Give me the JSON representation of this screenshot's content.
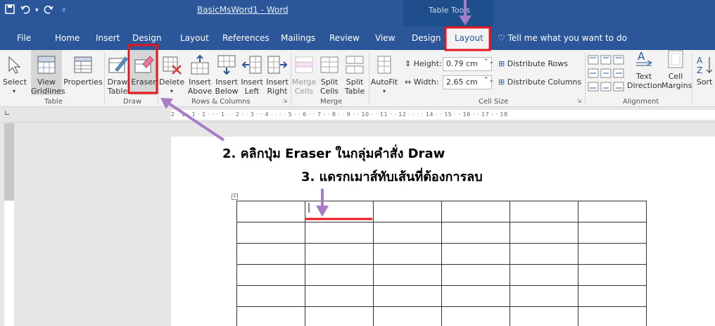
{
  "title_bar": {
    "doc_title": "BasicMsWord1 - Word",
    "context_header": "Table Tools"
  },
  "tabs": [
    "File",
    "Home",
    "Insert",
    "Design",
    "Layout",
    "References",
    "Mailings",
    "Review",
    "View",
    "Design",
    "Layout"
  ],
  "tell_me": "Tell me what you want to do",
  "ribbon": {
    "select": "Select",
    "view_gridlines_1": "View",
    "view_gridlines_2": "Gridlines",
    "properties": "Properties",
    "draw_table_1": "Draw",
    "draw_table_2": "Table",
    "eraser": "Eraser",
    "delete": "Delete",
    "insert_above_1": "Insert",
    "insert_above_2": "Above",
    "insert_below_1": "Insert",
    "insert_below_2": "Below",
    "insert_left_1": "Insert",
    "insert_left_2": "Left",
    "insert_right_1": "Insert",
    "insert_right_2": "Right",
    "merge_cells_1": "Merge",
    "merge_cells_2": "Cells",
    "split_cells_1": "Split",
    "split_cells_2": "Cells",
    "split_table_1": "Split",
    "split_table_2": "Table",
    "autofit": "AutoFit",
    "height_label": "Height:",
    "height_value": "0.79 cm",
    "width_label": "Width:",
    "width_value": "2.65 cm",
    "distribute_rows": "Distribute Rows",
    "distribute_columns": "Distribute Columns",
    "text_direction_1": "Text",
    "text_direction_2": "Direction",
    "cell_margins_1": "Cell",
    "cell_margins_2": "Margins",
    "sort": "Sort",
    "groups": {
      "table": "Table",
      "draw": "Draw",
      "rows_columns": "Rows & Columns",
      "merge": "Merge",
      "cell_size": "Cell Size",
      "alignment": "Alignment"
    }
  },
  "ruler_text": "2 · 1 · 1 · 1 · · · 1 · · 2 · · 3 · · 4 · · · · 5 · · 6 · · 7 · · 8 · · 9 · · 10 · · 11 · · 12 · · · · 14 · · 15 · · 16 · · 17 · · 18",
  "annotations": {
    "step2": "2. คลิกปุ่ม Eraser ในกลุ่มคำสั่ง Draw",
    "step3": "3. แดรกเมาส์ทับเส้นที่ต้องการลบ"
  },
  "colors": {
    "word_blue": "#2b579a",
    "highlight_red": "#e8141c",
    "arrow_purple": "#a87cc4"
  }
}
